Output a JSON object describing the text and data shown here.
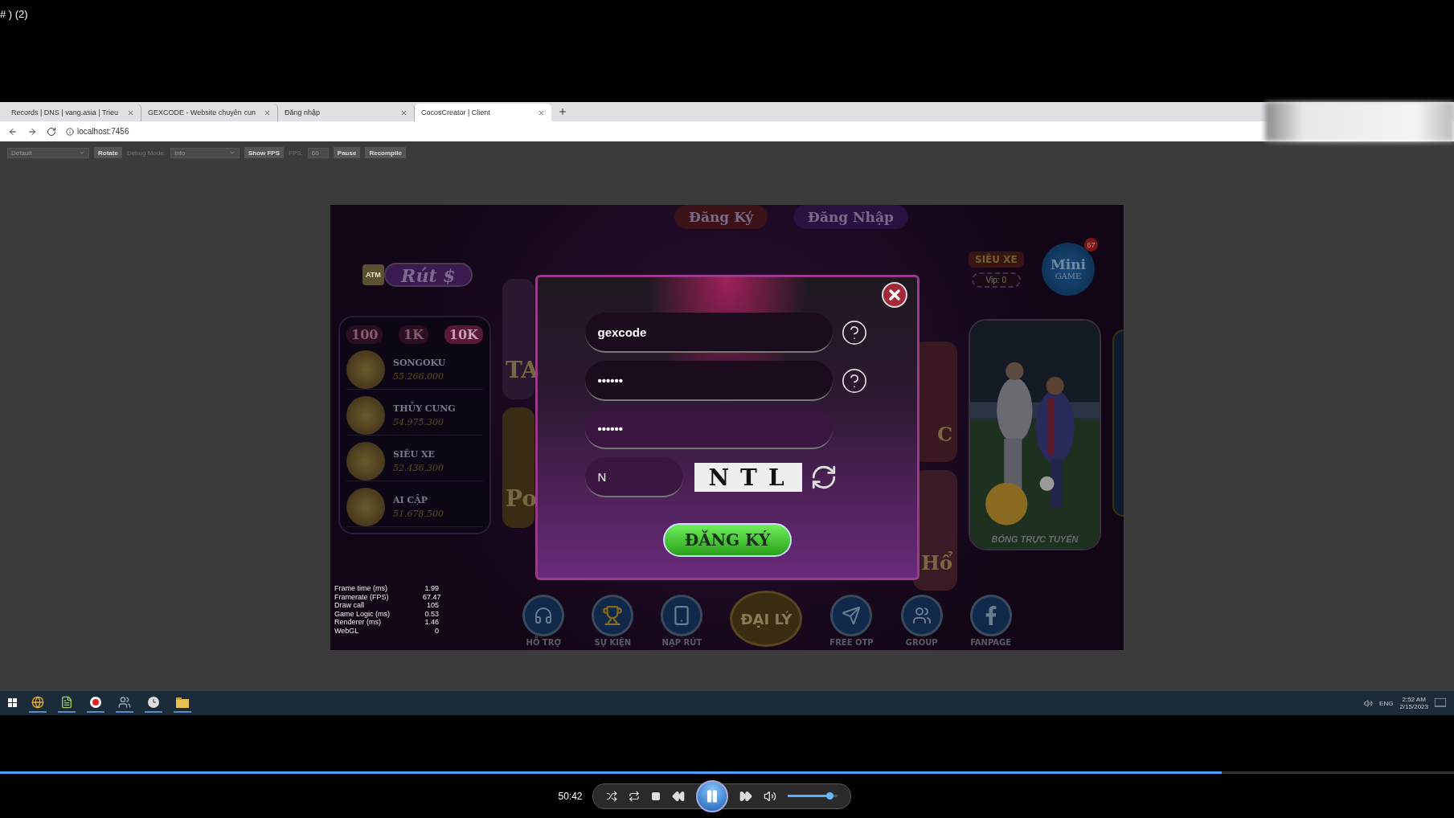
{
  "video_title": "# ) (2)",
  "browser": {
    "tabs": [
      {
        "label": "Records | DNS | vang.asia | Trieu",
        "selected": false
      },
      {
        "label": "GEXCODE - Website chuyên cun",
        "selected": false
      },
      {
        "label": "Đăng nhập",
        "selected": false
      },
      {
        "label": "CocosCreator | Client",
        "selected": true
      }
    ],
    "address": "localhost:7456"
  },
  "toolbar": {
    "preview_select": "Default",
    "rotate": "Rotate",
    "debug_label": "Debug Mode:",
    "debug_select": "Info",
    "show_fps": "Show FPS",
    "fps_label": "FPS:",
    "fps_value": "60",
    "pause": "Pause",
    "recompile": "Recompile"
  },
  "game": {
    "header_buttons": [
      "Đăng Ký",
      "Đăng Nhập"
    ],
    "withdraw": {
      "atm": "ATM",
      "label": "Rút $"
    },
    "jackpot": {
      "tabs": [
        {
          "label": "100",
          "selected": false
        },
        {
          "label": "1K",
          "selected": false
        },
        {
          "label": "10K",
          "selected": true
        }
      ],
      "rows": [
        {
          "name": "SONGOKU",
          "amount": "55.266.000"
        },
        {
          "name": "THỦY CUNG",
          "amount": "54.975.300"
        },
        {
          "name": "SIÊU XE",
          "amount": "52.436.300"
        },
        {
          "name": "AI CẬP",
          "amount": "51.678.500"
        }
      ]
    },
    "left_tiles": [
      "TA",
      "Po"
    ],
    "right_tiles": [
      "C",
      "Hổ"
    ],
    "supercar": {
      "title": "SIÊU XE",
      "vip_label": "Vip:",
      "vip_value": "0"
    },
    "mini_game": {
      "line_1": "Mini",
      "line_2": "GAME",
      "badge": "67"
    },
    "featured": {
      "caption": "BÓNG TRỰC TUYẾN"
    },
    "nav": [
      {
        "label": "HỖ TRỢ",
        "kind": "support"
      },
      {
        "label": "SỰ KIỆN",
        "kind": "event"
      },
      {
        "label": "NẠP RÚT",
        "kind": "deposit"
      },
      {
        "label": "ĐẠI LÝ",
        "kind": "agent"
      },
      {
        "label": "FREE OTP",
        "kind": "otp"
      },
      {
        "label": "GROUP",
        "kind": "group"
      },
      {
        "label": "FANPAGE",
        "kind": "fanpage"
      }
    ],
    "stats": [
      {
        "label": "Frame time (ms)",
        "value": "1.99"
      },
      {
        "label": "Framerate (FPS)",
        "value": "67.47"
      },
      {
        "label": "Draw call",
        "value": "105"
      },
      {
        "label": "Game Logic (ms)",
        "value": "0.53"
      },
      {
        "label": "Renderer (ms)",
        "value": "1.46"
      },
      {
        "label": "WebGL",
        "value": "0"
      }
    ]
  },
  "dialog": {
    "username": "gexcode",
    "password": "••••••",
    "confirm": "••••••",
    "captcha_input": "N",
    "captcha": "NTL",
    "submit": "ĐĂNG KÝ"
  },
  "taskbar": {
    "lang": "ENG",
    "time": "2:52 AM",
    "date": "2/15/2023"
  },
  "player": {
    "time": "50:42",
    "progress": {
      "level": 0.84
    },
    "volume": {
      "level": 0.85
    },
    "playing": true
  }
}
